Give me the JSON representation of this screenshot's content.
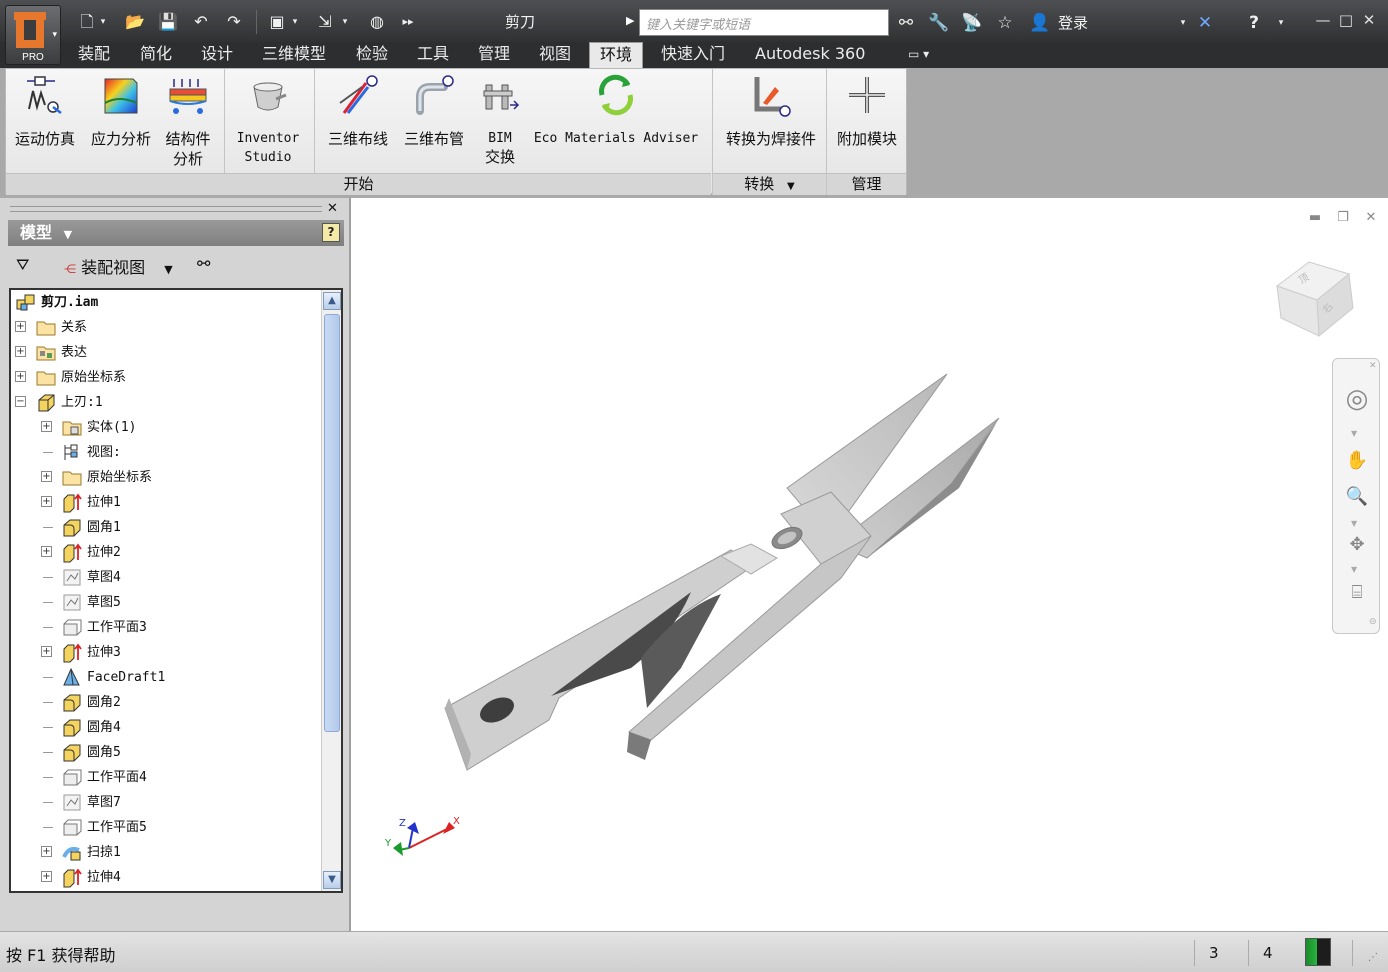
{
  "titlebar": {
    "app_badge": "PRO",
    "document_title": "剪刀",
    "search_placeholder": "键入关键字或短语",
    "login_label": "登录"
  },
  "tabs": [
    "装配",
    "简化",
    "设计",
    "三维模型",
    "检验",
    "工具",
    "管理",
    "视图",
    "环境",
    "快速入门",
    "Autodesk 360"
  ],
  "active_tab": "环境",
  "ribbon": {
    "buttons": [
      {
        "label_line1": "运动仿真",
        "label_line2": "",
        "icon": "dynamic-simulation-icon"
      },
      {
        "label_line1": "应力分析",
        "label_line2": "",
        "icon": "stress-analysis-icon"
      },
      {
        "label_line1": "结构件",
        "label_line2": "分析",
        "icon": "frame-analysis-icon"
      },
      {
        "label_line1": "Inventor",
        "label_line2": "Studio",
        "icon": "inventor-studio-icon"
      },
      {
        "label_line1": "三维布线",
        "label_line2": "",
        "icon": "cable-harness-icon"
      },
      {
        "label_line1": "三维布管",
        "label_line2": "",
        "icon": "tube-pipe-icon"
      },
      {
        "label_line1": "BIM",
        "label_line2": "交换",
        "icon": "bim-exchange-icon"
      },
      {
        "label_line1": "Eco Materials Adviser",
        "label_line2": "",
        "icon": "eco-materials-icon"
      },
      {
        "label_line1": "转换为焊接件",
        "label_line2": "",
        "icon": "convert-weldment-icon"
      },
      {
        "label_line1": "附加模块",
        "label_line2": "",
        "icon": "add-in-icon"
      }
    ],
    "groups": {
      "begin": "开始",
      "convert": "转换",
      "manage": "管理"
    }
  },
  "browser": {
    "title": "模型",
    "view_label": "装配视图",
    "help_glyph": "?",
    "tree": [
      {
        "label": "剪刀.iam",
        "level": 0,
        "expander": "",
        "icon": "assembly"
      },
      {
        "label": "关系",
        "level": 0,
        "expander": "+",
        "icon": "folder"
      },
      {
        "label": "表达",
        "level": 0,
        "expander": "+",
        "icon": "representations"
      },
      {
        "label": "原始坐标系",
        "level": 0,
        "expander": "+",
        "icon": "folder"
      },
      {
        "label": "上刃:1",
        "level": 0,
        "expander": "−",
        "icon": "part"
      },
      {
        "label": "实体(1)",
        "level": 1,
        "expander": "+",
        "icon": "solid-folder"
      },
      {
        "label": "视图:",
        "level": 1,
        "expander": "",
        "icon": "view"
      },
      {
        "label": "原始坐标系",
        "level": 1,
        "expander": "+",
        "icon": "folder"
      },
      {
        "label": "拉伸1",
        "level": 1,
        "expander": "+",
        "icon": "extrude"
      },
      {
        "label": "圆角1",
        "level": 1,
        "expander": "",
        "icon": "fillet"
      },
      {
        "label": "拉伸2",
        "level": 1,
        "expander": "+",
        "icon": "extrude"
      },
      {
        "label": "草图4",
        "level": 1,
        "expander": "",
        "icon": "sketch"
      },
      {
        "label": "草图5",
        "level": 1,
        "expander": "",
        "icon": "sketch"
      },
      {
        "label": "工作平面3",
        "level": 1,
        "expander": "",
        "icon": "workplane"
      },
      {
        "label": "拉伸3",
        "level": 1,
        "expander": "+",
        "icon": "extrude"
      },
      {
        "label": "FaceDraft1",
        "level": 1,
        "expander": "",
        "icon": "facedraft"
      },
      {
        "label": "圆角2",
        "level": 1,
        "expander": "",
        "icon": "fillet"
      },
      {
        "label": "圆角4",
        "level": 1,
        "expander": "",
        "icon": "fillet"
      },
      {
        "label": "圆角5",
        "level": 1,
        "expander": "",
        "icon": "fillet"
      },
      {
        "label": "工作平面4",
        "level": 1,
        "expander": "",
        "icon": "workplane"
      },
      {
        "label": "草图7",
        "level": 1,
        "expander": "",
        "icon": "sketch"
      },
      {
        "label": "工作平面5",
        "level": 1,
        "expander": "",
        "icon": "workplane"
      },
      {
        "label": "扫掠1",
        "level": 1,
        "expander": "+",
        "icon": "sweep"
      },
      {
        "label": "拉伸4",
        "level": 1,
        "expander": "+",
        "icon": "extrude"
      }
    ]
  },
  "viewport": {
    "axis_labels": {
      "x": "X",
      "y": "Y",
      "z": "Z"
    }
  },
  "statusbar": {
    "help_text": "按 F1 获得帮助",
    "count_a": "3",
    "count_b": "4"
  },
  "colors": {
    "accent": "#e8772e",
    "titlebar": "#3a3c3e",
    "ribbon_bg": "#a9a9a9",
    "axis_x": "#d22",
    "axis_y": "#1a9a2a",
    "axis_z": "#2233cc"
  }
}
